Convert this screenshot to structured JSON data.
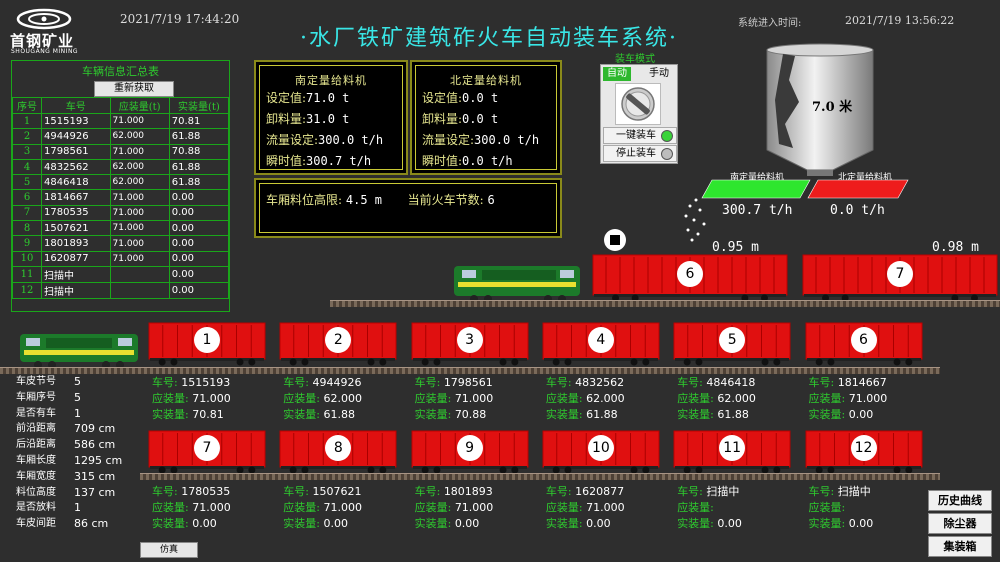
{
  "header": {
    "logo_name": "首钢矿业",
    "logo_sub": "SHOUGANG MINING",
    "clock": "2021/7/19  17:44:20",
    "title": "水厂铁矿建筑砟火车自动装车系统",
    "entry_label": "系统进入时间:",
    "entry_time": "2021/7/19  13:56:22"
  },
  "summary": {
    "title": "车辆信息汇总表",
    "refresh": "重新获取",
    "columns": [
      "序号",
      "车号",
      "应装量(t)",
      "实装量(t)"
    ],
    "rows": [
      {
        "idx": "1",
        "no": "1515193",
        "plan": "71.000",
        "actual": "70.81"
      },
      {
        "idx": "2",
        "no": "4944926",
        "plan": "62.000",
        "actual": "61.88"
      },
      {
        "idx": "3",
        "no": "1798561",
        "plan": "71.000",
        "actual": "70.88"
      },
      {
        "idx": "4",
        "no": "4832562",
        "plan": "62.000",
        "actual": "61.88"
      },
      {
        "idx": "5",
        "no": "4846418",
        "plan": "62.000",
        "actual": "61.88"
      },
      {
        "idx": "6",
        "no": "1814667",
        "plan": "71.000",
        "actual": "0.00"
      },
      {
        "idx": "7",
        "no": "1780535",
        "plan": "71.000",
        "actual": "0.00"
      },
      {
        "idx": "8",
        "no": "1507621",
        "plan": "71.000",
        "actual": "0.00"
      },
      {
        "idx": "9",
        "no": "1801893",
        "plan": "71.000",
        "actual": "0.00"
      },
      {
        "idx": "10",
        "no": "1620877",
        "plan": "71.000",
        "actual": "0.00"
      },
      {
        "idx": "11",
        "no": "扫描中",
        "plan": "",
        "actual": "0.00"
      },
      {
        "idx": "12",
        "no": "扫描中",
        "plan": "",
        "actual": "0.00"
      }
    ]
  },
  "south_feeder": {
    "title": "南定量给料机",
    "rows": [
      {
        "k": "设定值:",
        "v": "71.0 t"
      },
      {
        "k": "卸料量:",
        "v": "31.0 t"
      },
      {
        "k": "流量设定:",
        "v": "300.0 t/h"
      },
      {
        "k": "瞬时值:",
        "v": "300.7 t/h"
      }
    ]
  },
  "north_feeder": {
    "title": "北定量给料机",
    "rows": [
      {
        "k": "设定值:",
        "v": "0.0 t"
      },
      {
        "k": "卸料量:",
        "v": "0.0 t"
      },
      {
        "k": "流量设定:",
        "v": "300.0 t/h"
      },
      {
        "k": "瞬时值:",
        "v": "0.0 t/h"
      }
    ]
  },
  "status_panel": {
    "height_label": "车厢料位高限:",
    "height_value": "4.5 m",
    "count_label": "当前火车节数:",
    "count_value": "6"
  },
  "mode": {
    "title": "装车模式",
    "auto": "自动",
    "manual": "手动",
    "one_key": "一键装车",
    "stop": "停止装车",
    "one_key_lamp": "#39d339",
    "stop_lamp": "#bdbdbd"
  },
  "silo": {
    "level": "7.0 米"
  },
  "conveyors": {
    "south_label": "南定量给料机",
    "north_label": "北定量给料机",
    "south_value": "300.7 t/h",
    "north_value": "0.0 t/h",
    "south_color": "#2ee62e",
    "north_color": "#ee1c1c"
  },
  "loading_cars": [
    {
      "num": "6",
      "dist": "0.95 m"
    },
    {
      "num": "7",
      "dist": "0.98 m"
    }
  ],
  "labels": {
    "car_no": "车号:",
    "plan": "应装量:",
    "actual": "实装量:"
  },
  "train_row1": [
    {
      "num": "1",
      "no": "1515193",
      "plan": "71.000",
      "actual": "70.81"
    },
    {
      "num": "2",
      "no": "4944926",
      "plan": "62.000",
      "actual": "61.88"
    },
    {
      "num": "3",
      "no": "1798561",
      "plan": "71.000",
      "actual": "70.88"
    },
    {
      "num": "4",
      "no": "4832562",
      "plan": "62.000",
      "actual": "61.88"
    },
    {
      "num": "5",
      "no": "4846418",
      "plan": "62.000",
      "actual": "61.88"
    },
    {
      "num": "6",
      "no": "1814667",
      "plan": "71.000",
      "actual": "0.00"
    }
  ],
  "train_row2": [
    {
      "num": "7",
      "no": "1780535",
      "plan": "71.000",
      "actual": "0.00"
    },
    {
      "num": "8",
      "no": "1507621",
      "plan": "71.000",
      "actual": "0.00"
    },
    {
      "num": "9",
      "no": "1801893",
      "plan": "71.000",
      "actual": "0.00"
    },
    {
      "num": "10",
      "no": "1620877",
      "plan": "71.000",
      "actual": "0.00"
    },
    {
      "num": "11",
      "no": "扫描中",
      "plan": "",
      "actual": "0.00"
    },
    {
      "num": "12",
      "no": "扫描中",
      "plan": "",
      "actual": "0.00"
    }
  ],
  "status_list": [
    {
      "k": "车皮节号",
      "v": "5"
    },
    {
      "k": "车厢序号",
      "v": "5"
    },
    {
      "k": "是否有车",
      "v": "1"
    },
    {
      "k": "前沿距离",
      "v": "709 cm"
    },
    {
      "k": "后沿距离",
      "v": "586 cm"
    },
    {
      "k": "车厢长度",
      "v": "1295 cm"
    },
    {
      "k": "车厢宽度",
      "v": "315 cm"
    },
    {
      "k": "料位高度",
      "v": "137 cm"
    },
    {
      "k": "是否放料",
      "v": "1"
    },
    {
      "k": "车皮间距",
      "v": "86 cm"
    }
  ],
  "buttons": {
    "sim": "仿真",
    "history": "历史曲线",
    "dust": "除尘器",
    "container": "集装箱"
  },
  "colors": {
    "car_red": "#e01010",
    "green_label": "#2ecc2e",
    "title_cyan": "#39e6e6"
  }
}
